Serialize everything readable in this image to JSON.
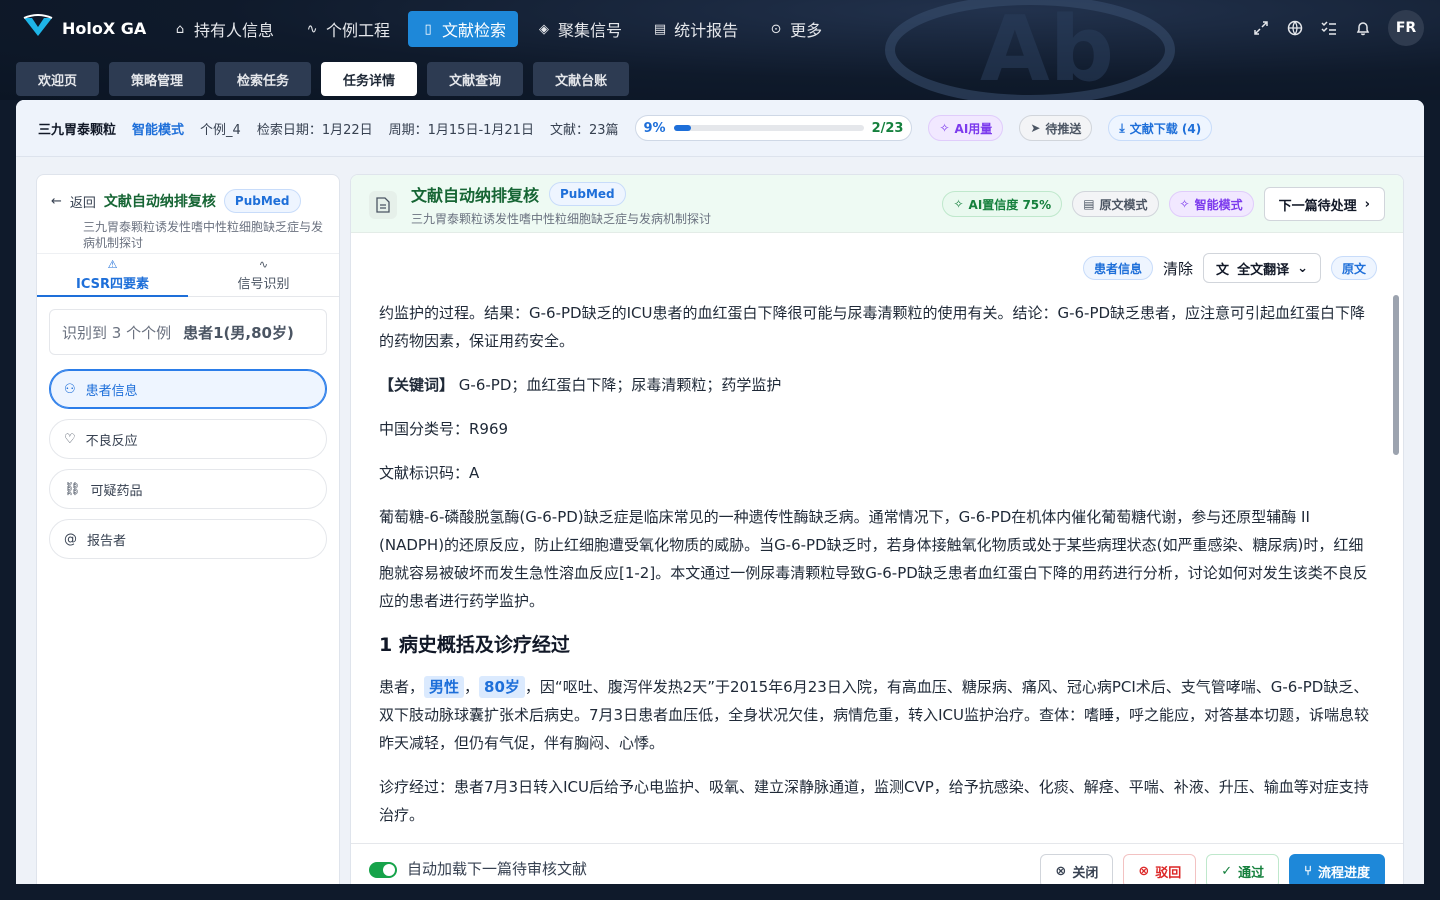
{
  "app": {
    "name": "HoloX GA",
    "avatar_initials": "FR"
  },
  "nav": [
    {
      "label": "持有人信息",
      "icon": "bank-icon"
    },
    {
      "label": "个例工程",
      "icon": "pulse-icon"
    },
    {
      "label": "文献检索",
      "icon": "book-icon",
      "active": true
    },
    {
      "label": "聚集信号",
      "icon": "layers-icon"
    },
    {
      "label": "统计报告",
      "icon": "report-icon"
    },
    {
      "label": "更多",
      "icon": "more-icon"
    }
  ],
  "tabs": [
    "欢迎页",
    "策略管理",
    "检索任务",
    "任务详情",
    "文献查询",
    "文献台账"
  ],
  "active_tab": "任务详情",
  "infobar": {
    "drug": "三九胃泰颗粒",
    "mode": "智能模式",
    "case": "个例_4",
    "search_date": "检索日期：1月22日",
    "period": "周期：1月15日-1月21日",
    "docs": "文献：23篇",
    "progress_pct": "9%",
    "progress_fraction": 0.09,
    "progress_count": "2/23",
    "ai_usage": "AI用量",
    "pending_push": "待推送",
    "download": "文献下载 (4)"
  },
  "side": {
    "back": "返回",
    "title": "文献自动纳排复核",
    "source": "PubMed",
    "subtitle": "三九胃泰颗粒诱发性嗜中性粒细胞缺乏症与发病机制探讨",
    "tab_icsr": "ICSR四要素",
    "tab_signal": "信号识别",
    "found": "识别到 3 个个例",
    "patient_summary": "患者1(男,80岁)",
    "options": [
      "患者信息",
      "不良反应",
      "可疑药品",
      "报告者"
    ]
  },
  "reader": {
    "title": "文献自动纳排复核",
    "source": "PubMed",
    "subtitle": "三九胃泰颗粒诱发性嗜中性粒细胞缺乏症与发病机制探讨",
    "ai_conf": "AI置信度 75%",
    "original_mode": "原文模式",
    "smart_mode": "智能模式",
    "next": "下一篇待处理",
    "patient_tag": "患者信息",
    "clear": "清除",
    "translate": "全文翻译",
    "original_tag": "原文",
    "p1": "约监护的过程。结果：G-6-PD缺乏的ICU患者的血红蛋白下降很可能与尿毒清颗粒的使用有关。结论：G-6-PD缺乏患者，应注意可引起血红蛋白下降的药物因素，保证用药安全。",
    "kw_label": "【关键词】",
    "kw_text": " G-6-PD；血红蛋白下降；尿毒清颗粒；药学监护",
    "cls": "中国分类号：R969",
    "docid": "文献标识码：A",
    "p2": "葡萄糖-6-磷酸脱氢酶(G-6-PD)缺乏症是临床常见的一种遗传性酶缺乏病。通常情况下，G-6-PD在机体内催化葡萄糖代谢，参与还原型辅酶 II (NADPH)的还原反应，防止红细胞遭受氧化物质的威胁。当G-6-PD缺乏时，若身体接触氧化物质或处于某些病理状态(如严重感染、糖尿病)时，红细胞就容易被破坏而发生急性溶血反应[1-2]。本文通过一例尿毒清颗粒导致G-6-PD缺乏患者血红蛋白下降的用药进行分析，讨论如何对发生该类不良反应的患者进行药学监护。",
    "h1": "1 病史概括及诊疗经过",
    "p3_pre": "患者，",
    "p3_sex": "男性",
    "p3_comma": "，",
    "p3_age": "80岁",
    "p3_post": "，因“呕吐、腹泻伴发热2天”于2015年6月23日入院，有高血压、糖尿病、痛风、冠心病PCI术后、支气管哮喘、G-6-PD缺乏、双下肢动脉球囊扩张术后病史。7月3日患者血压低，全身状况欠佳，病情危重，转入ICU监护治疗。查体：嗜睡，呼之能应，对答基本切题，诉喘息较昨天减轻，但仍有气促，伴有胸闷、心悸。",
    "p4": "诊疗经过：患者7月3日转入ICU后给予心电监护、吸氧、建立深静脉通道，监测CVP，给予抗感染、化痰、解痉、平喘、补液、升压、输血等对症支持治疗。",
    "auto_load": "自动加载下一篇待审核文献",
    "close": "关闭",
    "reject": "驳回",
    "approve": "通过",
    "flow": "流程进度"
  }
}
